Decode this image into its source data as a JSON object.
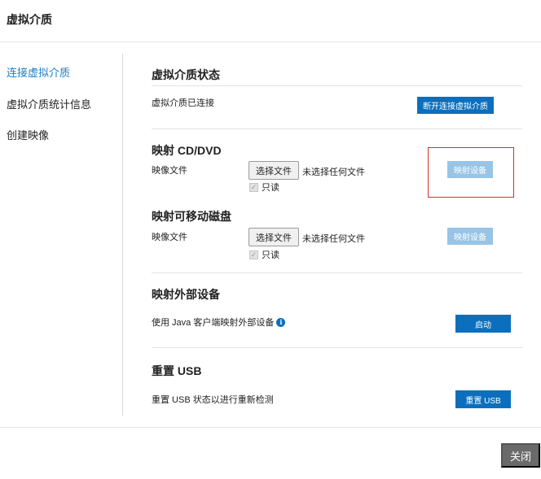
{
  "dialog": {
    "title": "虚拟介质"
  },
  "sidebar": {
    "items": [
      {
        "label": "连接虚拟介质",
        "active": true
      },
      {
        "label": "虚拟介质统计信息",
        "active": false
      },
      {
        "label": "创建映像",
        "active": false
      }
    ]
  },
  "status": {
    "title": "虚拟介质状态",
    "text": "虚拟介质已连接",
    "disconnect_label": "断开连接虚拟介质"
  },
  "cd_dvd": {
    "title": "映射 CD/DVD",
    "image_label": "映像文件",
    "choose_file_label": "选择文件",
    "no_file_text": "未选择任何文件",
    "readonly_label": "只读",
    "readonly_checked": true,
    "map_label": "映射设备"
  },
  "removable": {
    "title": "映射可移动磁盘",
    "image_label": "映像文件",
    "choose_file_label": "选择文件",
    "no_file_text": "未选择任何文件",
    "readonly_label": "只读",
    "readonly_checked": true,
    "map_label": "映射设备"
  },
  "external": {
    "title": "映射外部设备",
    "text": "使用 Java 客户端映射外部设备",
    "start_label": "启动"
  },
  "usb": {
    "title": "重置 USB",
    "text": "重置 USB 状态以进行重新检测",
    "reset_label": "重置 USB"
  },
  "footer": {
    "close_label": "关闭"
  },
  "colors": {
    "accent": "#0c6fbd",
    "disabled": "#98c4e6",
    "active_link": "#1a7fc1",
    "highlight": "#d0312d",
    "close_button": "#6a6a6a"
  }
}
